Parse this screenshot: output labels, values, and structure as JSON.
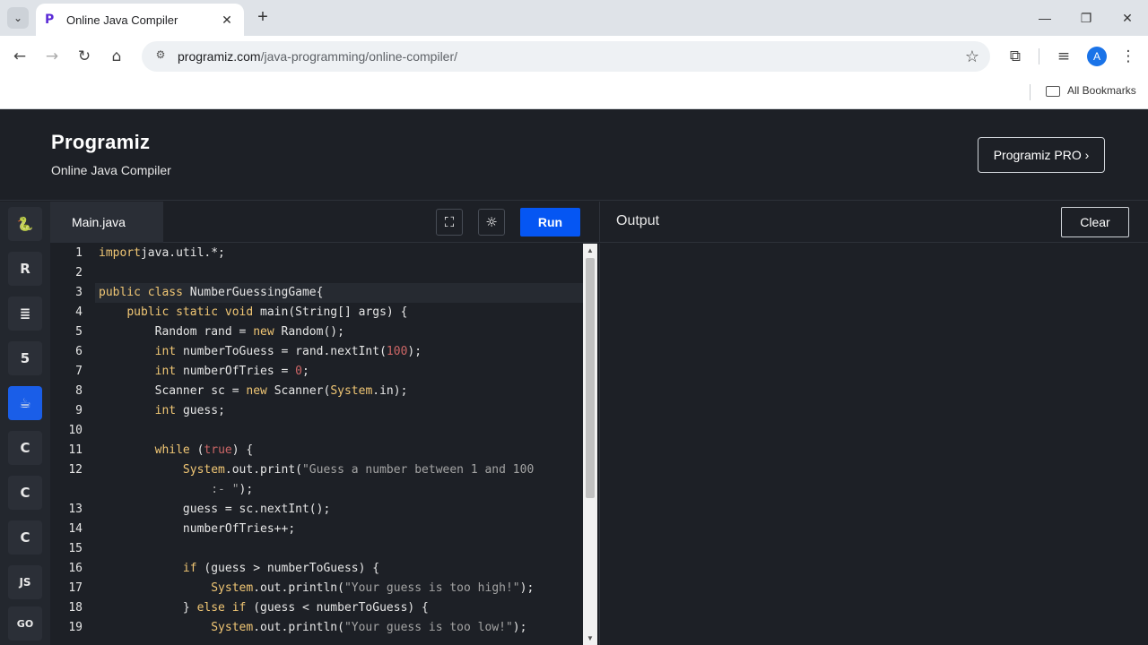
{
  "browser": {
    "tab_title": "Online Java Compiler",
    "tab_favicon": "P",
    "url_host": "programiz.com",
    "url_path": "/java-programming/online-compiler/",
    "avatar_letter": "A",
    "bookmarks_label": "All Bookmarks"
  },
  "site": {
    "logo": "Programiz",
    "subtitle": "Online Java Compiler",
    "pro_button": "Programiz PRO ›"
  },
  "languages": [
    {
      "name": "python",
      "glyph": "🐍"
    },
    {
      "name": "r",
      "glyph": "R"
    },
    {
      "name": "sql",
      "glyph": "≣"
    },
    {
      "name": "html",
      "glyph": "5"
    },
    {
      "name": "java",
      "glyph": "☕"
    },
    {
      "name": "c",
      "glyph": "C"
    },
    {
      "name": "cpp",
      "glyph": "C"
    },
    {
      "name": "csharp",
      "glyph": "C"
    },
    {
      "name": "js",
      "glyph": "JS"
    },
    {
      "name": "go",
      "glyph": "GO"
    }
  ],
  "editor": {
    "file_tab": "Main.java",
    "run_label": "Run",
    "line_numbers": [
      "1",
      "2",
      "3",
      "4",
      "5",
      "6",
      "7",
      "8",
      "9",
      "10",
      "11",
      "12",
      "",
      "13",
      "14",
      "15",
      "16",
      "17",
      "18",
      "19"
    ]
  },
  "output": {
    "title": "Output",
    "clear_label": "Clear"
  },
  "colors": {
    "accent": "#0556f3",
    "background": "#1d2026"
  }
}
